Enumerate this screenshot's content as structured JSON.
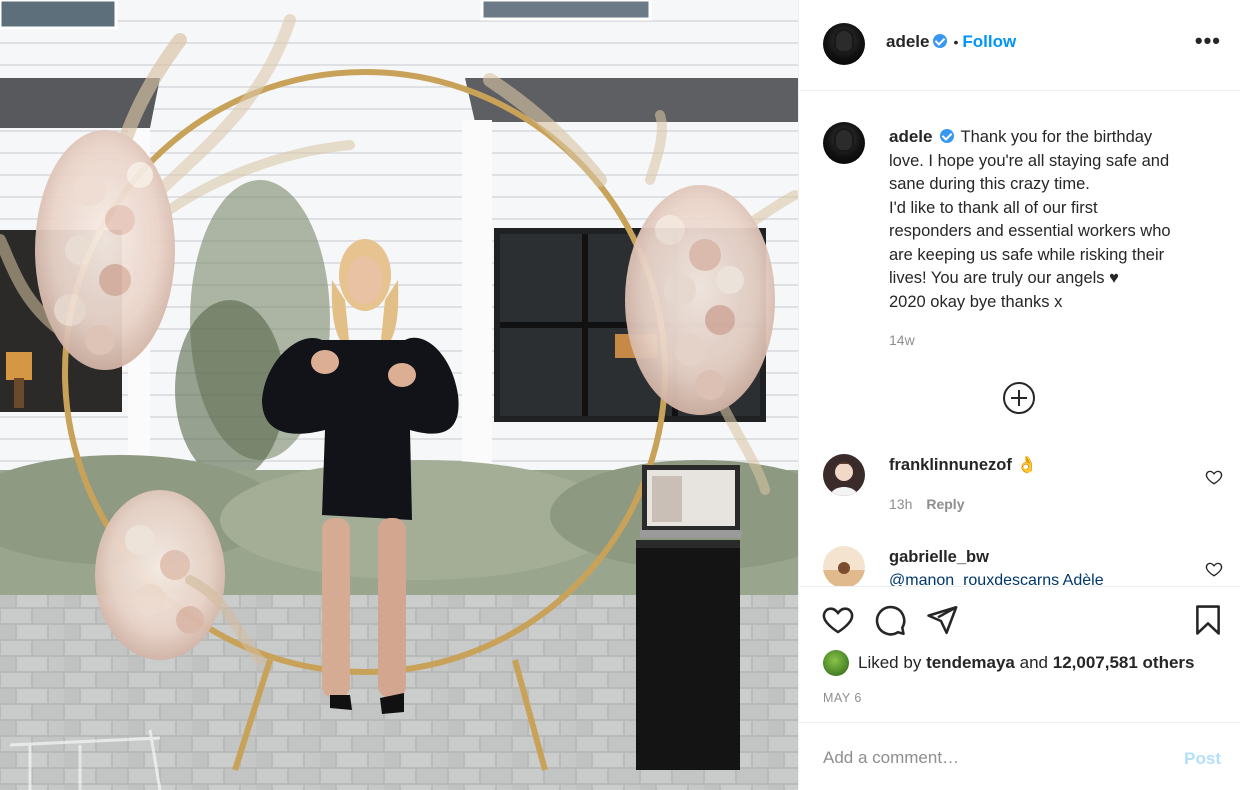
{
  "post": {
    "username": "adele",
    "separator": "•",
    "follow_label": "Follow",
    "more_label": "•••"
  },
  "caption": {
    "username": "adele",
    "lines": [
      "Thank you for the birthday",
      "love. I hope you're all staying safe and",
      "sane during this crazy time.",
      "I'd like to thank all of our first",
      "responders and essential workers who",
      "are keeping us safe while risking their",
      "lives! You are truly our angels ♥",
      "2020 okay bye thanks x"
    ],
    "time": "14w"
  },
  "comments": [
    {
      "username": "franklinnunezof",
      "emoji": "👌",
      "time": "13h",
      "reply_label": "Reply"
    },
    {
      "username": "gabrielle_bw",
      "text": "@manon_rouxdescarns Adèle"
    }
  ],
  "likes": {
    "prefix": "Liked by",
    "user": "tendemaya",
    "conjunction": "and",
    "count": "12,007,581 others"
  },
  "date": "MAY 6",
  "add_comment": {
    "placeholder": "Add a comment…",
    "post_label": "Post"
  },
  "icons": {
    "verified": "verified-badge-icon",
    "more": "more-options-icon",
    "load_more": "plus-circle-icon",
    "like": "heart-icon",
    "comment": "comment-bubble-icon",
    "share": "paper-plane-icon",
    "save": "bookmark-icon"
  },
  "colors": {
    "accent": "#0095f6",
    "verified": "#3897f0",
    "muted": "#8e8e8e",
    "post_disabled": "#b2dffc"
  }
}
